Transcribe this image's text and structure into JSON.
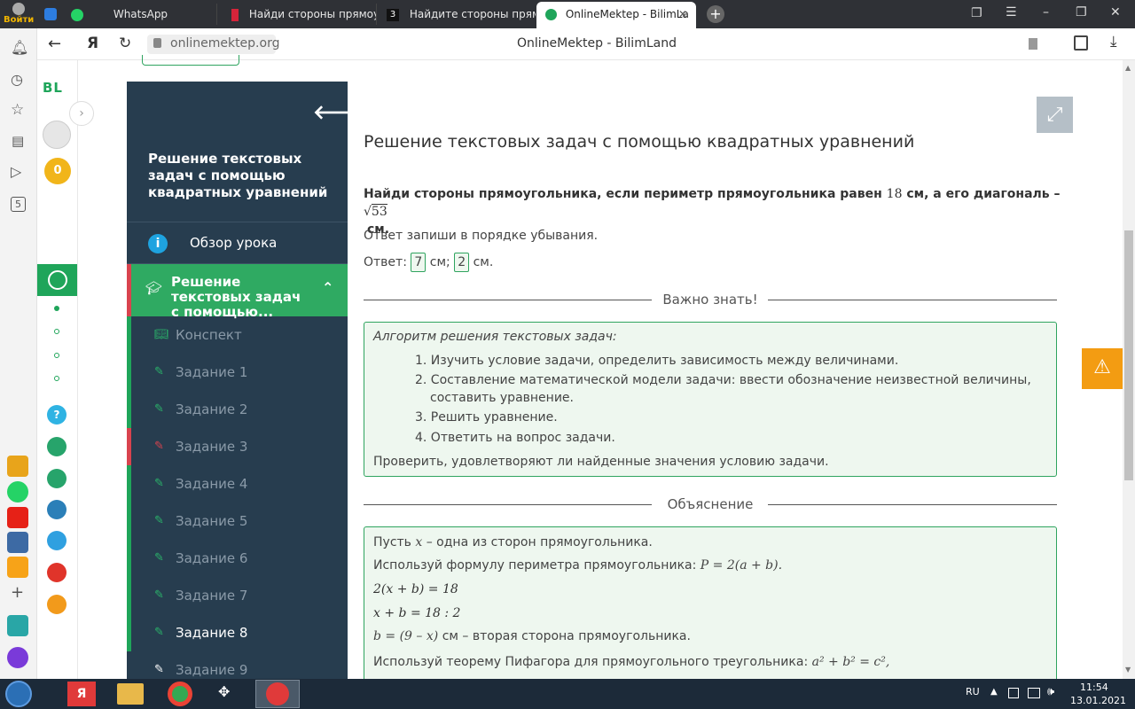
{
  "browser": {
    "login_label": "Войти",
    "tabs": [
      {
        "title": "WhatsApp",
        "active": false
      },
      {
        "title": "Найди стороны прямоуго",
        "active": false
      },
      {
        "title": "Найдите стороны прямоу",
        "active": false
      },
      {
        "title": "OnlineMektep - BilimLa",
        "active": true
      }
    ],
    "address": "onlinemektep.org",
    "page_title": "OnlineMektep - BilimLand"
  },
  "sidebar": {
    "logo": "BL",
    "coins": "0"
  },
  "lesson": {
    "title": "Решение текстовых задач с помощью квадратных уравнений",
    "overview_label": "Обзор урока",
    "current_section": "Решение текстовых задач с помощью...",
    "items": [
      {
        "label": "Конспект",
        "icon": "book-icon"
      },
      {
        "label": "Задание 1",
        "icon": "edit-icon"
      },
      {
        "label": "Задание 2",
        "icon": "edit-icon"
      },
      {
        "label": "Задание 3",
        "icon": "edit-icon"
      },
      {
        "label": "Задание 4",
        "icon": "edit-icon"
      },
      {
        "label": "Задание 5",
        "icon": "edit-icon"
      },
      {
        "label": "Задание 6",
        "icon": "edit-icon"
      },
      {
        "label": "Задание 7",
        "icon": "edit-icon"
      },
      {
        "label": "Задание 8",
        "icon": "edit-icon"
      },
      {
        "label": "Задание 9",
        "icon": "edit-icon"
      }
    ]
  },
  "main": {
    "heading": "Решение текстовых задач с помощью квадратных уравнений",
    "question_part1": "Найди стороны прямоугольника, если периметр прямоугольника равен",
    "question_num": "18",
    "question_part2": "см, а его диагональ –",
    "question_sqrt": "53",
    "question_unit": "см.",
    "instruction": "Ответ запиши в порядке убывания.",
    "answer_label": "Ответ:",
    "answer_1": "7",
    "answer_sep": "см;",
    "answer_2": "2",
    "answer_end": "см.",
    "important_title": "Важно знать!",
    "algorithm_title": "Алгоритм решения текстовых задач:",
    "algorithm_steps": [
      "1. Изучить условие задачи, определить зависимость между величинами.",
      "2. Составление математической модели задачи: ввести обозначение неизвестной величины,",
      "составить уравнение.",
      "3. Решить уравнение.",
      "4. Ответить на вопрос задачи."
    ],
    "algorithm_check": "Проверить, удовлетворяют ли найденные значения условию задачи.",
    "explanation_title": "Объяснение",
    "expl_1_pre": "Пусть",
    "expl_1_var": "x",
    "expl_1_post": "– одна из сторон прямоугольника.",
    "expl_2": "Используй формулу периметра прямоугольника:",
    "expl_2_formula": "P = 2(a + b).",
    "expl_3": "2(x + b) = 18",
    "expl_4": "x + b = 18 : 2",
    "expl_5_formula": "b = (9 – x)",
    "expl_5_text": "см – вторая сторона прямоугольника.",
    "expl_6": "Используй теорему Пифагора для прямоугольного треугольника:",
    "expl_6_formula": "a² + b² = c²,"
  },
  "taskbar": {
    "lang": "RU",
    "time": "11:54",
    "date": "13.01.2021"
  },
  "colors": {
    "accent": "#1fa55a",
    "panel": "#273d4f",
    "warning": "#f39c12"
  }
}
